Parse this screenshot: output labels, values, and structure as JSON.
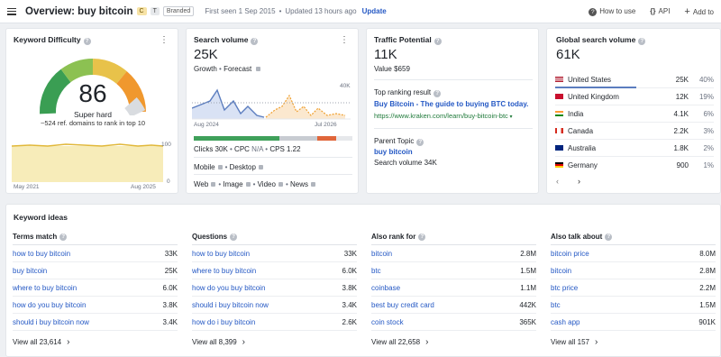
{
  "header": {
    "title": "Overview: buy bitcoin",
    "chip_c": "C",
    "chip_t": "T",
    "chip_branded": "Branded",
    "first_seen": "First seen 1 Sep 2015",
    "updated": "Updated 13 hours ago",
    "update_link": "Update",
    "how_to_use": "How to use",
    "api": "API",
    "add_to": "Add to"
  },
  "kd": {
    "title": "Keyword Difficulty",
    "value": "86",
    "label": "Super hard",
    "refdomains": "~524 ref. domains to rank in top 10",
    "y_max": "100",
    "y_min": "0",
    "x_start": "May 2021",
    "x_end": "Aug 2025",
    "colors": {
      "gauge_low": "#2e9b4f",
      "gauge_mid": "#e8c24a",
      "gauge_high": "#f0982e",
      "empty": "#d9dce0",
      "area": "#f3e6a6"
    }
  },
  "sv": {
    "title": "Search volume",
    "value": "25K",
    "growth": "Growth",
    "forecast": "Forecast",
    "y_top": "40K",
    "x_start": "Aug 2024",
    "x_end": "Jul 2026",
    "clicks": "Clicks 30K",
    "cpc": "CPC",
    "cpc_val": "N/A",
    "cps": "CPS 1.22",
    "mobile": "Mobile",
    "desktop": "Desktop",
    "web": "Web",
    "image": "Image",
    "video": "Video",
    "news": "News",
    "colors": {
      "line": "#5b7dbf",
      "forecast": "#f0a030"
    }
  },
  "tp": {
    "title": "Traffic Potential",
    "value": "11K",
    "value_usd": "Value $659",
    "top_label": "Top ranking result",
    "top_title": "Buy Bitcoin - The guide to buying BTC today.",
    "top_url": "https://www.kraken.com/learn/buy-bitcoin-btc",
    "parent_label": "Parent Topic",
    "parent_kw": "buy bitcoin",
    "parent_sv": "Search volume 34K"
  },
  "gsv": {
    "title": "Global search volume",
    "value": "61K",
    "countries": [
      {
        "name": "United States",
        "vol": "25K",
        "pct": "40%",
        "flag": "us"
      },
      {
        "name": "United Kingdom",
        "vol": "12K",
        "pct": "19%",
        "flag": "uk"
      },
      {
        "name": "India",
        "vol": "4.1K",
        "pct": "6%",
        "flag": "in"
      },
      {
        "name": "Canada",
        "vol": "2.2K",
        "pct": "3%",
        "flag": "ca"
      },
      {
        "name": "Australia",
        "vol": "1.8K",
        "pct": "2%",
        "flag": "au"
      },
      {
        "name": "Germany",
        "vol": "900",
        "pct": "1%",
        "flag": "de"
      }
    ]
  },
  "ideas": {
    "title": "Keyword ideas",
    "columns": [
      {
        "head": "Terms match",
        "rows": [
          [
            "how to buy bitcoin",
            "33K"
          ],
          [
            "buy bitcoin",
            "25K"
          ],
          [
            "where to buy bitcoin",
            "6.0K"
          ],
          [
            "how do you buy bitcoin",
            "3.8K"
          ],
          [
            "should i buy bitcoin now",
            "3.4K"
          ]
        ],
        "viewall": "View all 23,614"
      },
      {
        "head": "Questions",
        "rows": [
          [
            "how to buy bitcoin",
            "33K"
          ],
          [
            "where to buy bitcoin",
            "6.0K"
          ],
          [
            "how do you buy bitcoin",
            "3.8K"
          ],
          [
            "should i buy bitcoin now",
            "3.4K"
          ],
          [
            "how do i buy bitcoin",
            "2.6K"
          ]
        ],
        "viewall": "View all 8,399"
      },
      {
        "head": "Also rank for",
        "rows": [
          [
            "bitcoin",
            "2.8M"
          ],
          [
            "btc",
            "1.5M"
          ],
          [
            "coinbase",
            "1.1M"
          ],
          [
            "best buy credit card",
            "442K"
          ],
          [
            "coin stock",
            "365K"
          ]
        ],
        "viewall": "View all 22,658"
      },
      {
        "head": "Also talk about",
        "rows": [
          [
            "bitcoin price",
            "8.0M"
          ],
          [
            "bitcoin",
            "2.8M"
          ],
          [
            "btc price",
            "2.2M"
          ],
          [
            "btc",
            "1.5M"
          ],
          [
            "cash app",
            "901K"
          ]
        ],
        "viewall": "View all 157"
      }
    ]
  }
}
